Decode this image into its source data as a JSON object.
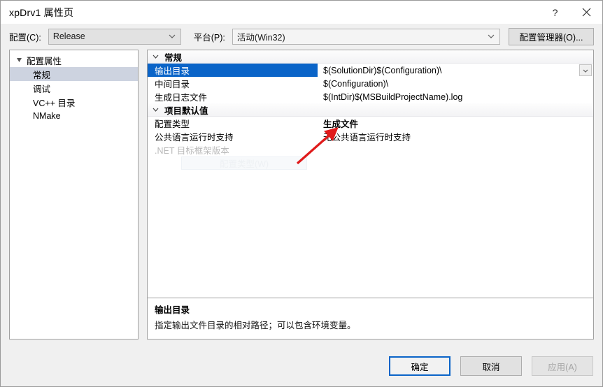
{
  "window": {
    "title": "xpDrv1 属性页",
    "help_label": "?",
    "close_label": "✕"
  },
  "configbar": {
    "config_label": "配置(C):",
    "config_value": "Release",
    "platform_label": "平台(P):",
    "platform_value": "活动(Win32)",
    "config_manager_button": "配置管理器(O)..."
  },
  "tree": {
    "root": {
      "label": "配置属性",
      "expanded": true
    },
    "items": [
      {
        "label": "常规",
        "selected": true
      },
      {
        "label": "调试",
        "selected": false
      },
      {
        "label": "VC++ 目录",
        "selected": false
      },
      {
        "label": "NMake",
        "selected": false
      }
    ]
  },
  "grid": {
    "sections": [
      {
        "label": "常规",
        "rows": [
          {
            "name": "输出目录",
            "value": "$(SolutionDir)$(Configuration)\\",
            "selected": true,
            "has_dropdown": true,
            "bold_value": false,
            "dim": false
          },
          {
            "name": "中间目录",
            "value": "$(Configuration)\\",
            "selected": false,
            "has_dropdown": false,
            "bold_value": false,
            "dim": false
          },
          {
            "name": "生成日志文件",
            "value": "$(IntDir)$(MSBuildProjectName).log",
            "selected": false,
            "has_dropdown": false,
            "bold_value": false,
            "dim": false
          }
        ]
      },
      {
        "label": "项目默认值",
        "rows": [
          {
            "name": "配置类型",
            "value": "生成文件",
            "selected": false,
            "has_dropdown": false,
            "bold_value": true,
            "dim": false
          },
          {
            "name": "公共语言运行时支持",
            "value": "无公共语言运行时支持",
            "selected": false,
            "has_dropdown": false,
            "bold_value": false,
            "dim": false
          },
          {
            "name": ".NET 目标框架版本",
            "value": "",
            "selected": false,
            "has_dropdown": false,
            "bold_value": false,
            "dim": true
          }
        ]
      }
    ],
    "ghost_tooltip": "配置类型(W)"
  },
  "description": {
    "title": "输出目录",
    "text": "指定输出文件目录的相对路径；可以包含环境变量。"
  },
  "footer": {
    "ok": "确定",
    "cancel": "取消",
    "apply": "应用(A)"
  },
  "annotation": {
    "arrow_color": "#e01b1b",
    "points_to": "生成文件"
  },
  "colors": {
    "selection_blue": "#0a64c8",
    "tree_selection": "#cdd3e0",
    "dialog_bg": "#f0f0f0"
  }
}
